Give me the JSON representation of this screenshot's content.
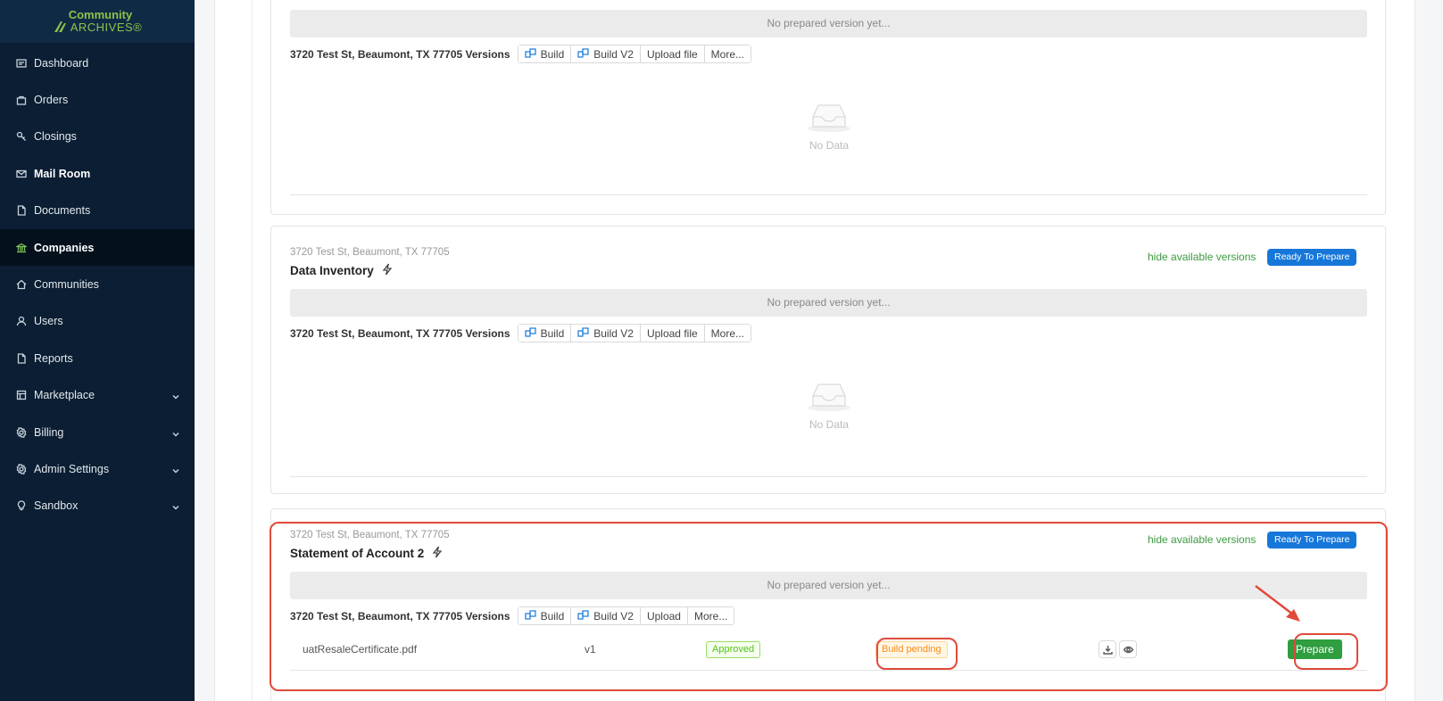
{
  "brand": {
    "line1": "Community",
    "line2": "ARCHIVES®"
  },
  "sidebar": {
    "items": [
      {
        "label": "Dashboard",
        "icon": "dashboard-icon"
      },
      {
        "label": "Orders",
        "icon": "bag-icon"
      },
      {
        "label": "Closings",
        "icon": "closings-icon"
      },
      {
        "label": "Mail Room",
        "icon": "mail-icon"
      },
      {
        "label": "Documents",
        "icon": "document-icon"
      },
      {
        "label": "Companies",
        "icon": "bank-icon"
      },
      {
        "label": "Communities",
        "icon": "home-icon"
      },
      {
        "label": "Users",
        "icon": "user-icon"
      },
      {
        "label": "Reports",
        "icon": "report-icon"
      },
      {
        "label": "Marketplace",
        "icon": "shop-icon"
      },
      {
        "label": "Billing",
        "icon": "settings-icon"
      },
      {
        "label": "Admin Settings",
        "icon": "settings-icon"
      },
      {
        "label": "Sandbox",
        "icon": "bulb-icon"
      }
    ],
    "active": "Companies"
  },
  "common": {
    "no_prepared": "No prepared version yet...",
    "no_data": "No Data",
    "hide_versions": "hide available versions",
    "ready_badge": "Ready To Prepare",
    "build": "Build",
    "build_v2": "Build V2",
    "upload_file": "Upload file",
    "upload": "Upload",
    "more": "More..."
  },
  "cards": [
    {
      "versions_label": "3720 Test St, Beaumont, TX 77705 Versions"
    },
    {
      "address": "3720 Test St, Beaumont, TX 77705",
      "title": "Data Inventory",
      "versions_label": "3720 Test St, Beaumont, TX 77705 Versions"
    },
    {
      "address": "3720 Test St, Beaumont, TX 77705",
      "title": "Statement of Account 2",
      "versions_label": "3720 Test St, Beaumont, TX 77705 Versions",
      "file": {
        "name": "uatResaleCertificate.pdf",
        "version": "v1",
        "approval": "Approved",
        "build_status": "Build pending",
        "action": "Prepare"
      }
    }
  ],
  "colors": {
    "accent": "#1677d9",
    "success": "#2e9e3f",
    "highlight": "#e04a3a",
    "sidebar_bg": "#0b1e33"
  }
}
